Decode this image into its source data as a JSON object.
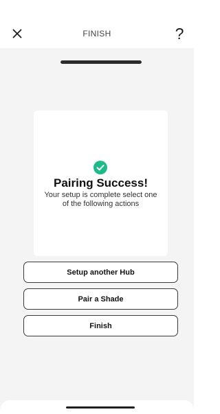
{
  "header": {
    "title": "FINISH",
    "close_icon": "close-icon",
    "help_label": "?"
  },
  "progress": {
    "value": 1.0
  },
  "card": {
    "icon": "check-circle-icon",
    "icon_color": "#20b98a",
    "title": "Pairing Success!",
    "message": "Your setup is complete select one of the following actions"
  },
  "actions": {
    "setup_hub_label": "Setup another Hub",
    "pair_shade_label": "Pair a Shade",
    "finish_label": "Finish"
  }
}
